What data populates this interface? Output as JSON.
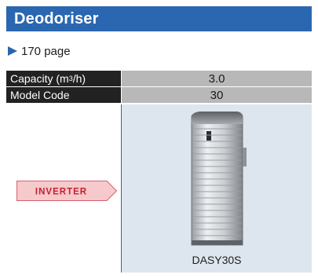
{
  "header": {
    "title": "Deodoriser"
  },
  "page_reference": {
    "text": "170 page"
  },
  "specs": {
    "capacity": {
      "label_prefix": "Capacity (m",
      "label_superscript": "3",
      "label_suffix": "/h)",
      "value": "3.0"
    },
    "model_code": {
      "label": "Model Code",
      "value": "30"
    }
  },
  "product": {
    "badge_text": "INVERTER",
    "model_name": "DASY30S",
    "icon": "air-purifier-unit-image"
  },
  "colors": {
    "header_blue": "#2b67b0",
    "label_bg": "#222222",
    "value_bg": "#b8b8b8",
    "image_bg": "#dde6ee",
    "badge_fill": "#f6c9cc",
    "badge_stroke": "#d6626a",
    "badge_text": "#c2202e"
  }
}
